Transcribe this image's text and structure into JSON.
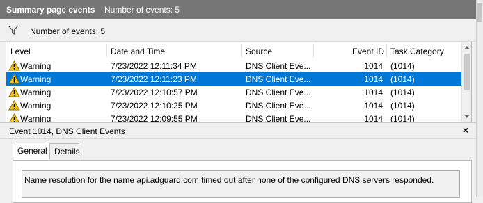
{
  "header": {
    "title": "Summary page events",
    "count_label": "Number of events: 5"
  },
  "filter_bar": {
    "count_label": "Number of events: 5"
  },
  "table": {
    "columns": [
      "Level",
      "Date and Time",
      "Source",
      "Event ID",
      "Task Category"
    ],
    "rows": [
      {
        "level": "Warning",
        "datetime": "7/23/2022 12:11:34 PM",
        "source": "DNS Client Eve...",
        "event_id": "1014",
        "task": "(1014)",
        "selected": false
      },
      {
        "level": "Warning",
        "datetime": "7/23/2022 12:11:23 PM",
        "source": "DNS Client Eve...",
        "event_id": "1014",
        "task": "(1014)",
        "selected": true
      },
      {
        "level": "Warning",
        "datetime": "7/23/2022 12:10:57 PM",
        "source": "DNS Client Eve...",
        "event_id": "1014",
        "task": "(1014)",
        "selected": false
      },
      {
        "level": "Warning",
        "datetime": "7/23/2022 12:10:25 PM",
        "source": "DNS Client Eve...",
        "event_id": "1014",
        "task": "(1014)",
        "selected": false
      },
      {
        "level": "Warning",
        "datetime": "7/23/2022 12:09:55 PM",
        "source": "DNS Client Eve...",
        "event_id": "1014",
        "task": "(1014)",
        "selected": false
      }
    ]
  },
  "details": {
    "title": "Event 1014, DNS Client Events",
    "close_label": "×",
    "tabs": [
      "General",
      "Details"
    ],
    "active_tab": "General",
    "description": "Name resolution for the name api.adguard.com timed out after none of the configured DNS servers responded."
  },
  "colors": {
    "header_bg": "#767676",
    "selection": "#0078d7",
    "warning_yellow": "#f5c518"
  },
  "icons": {
    "filter": "filter-icon",
    "warning": "warning-icon",
    "close": "close-icon"
  }
}
